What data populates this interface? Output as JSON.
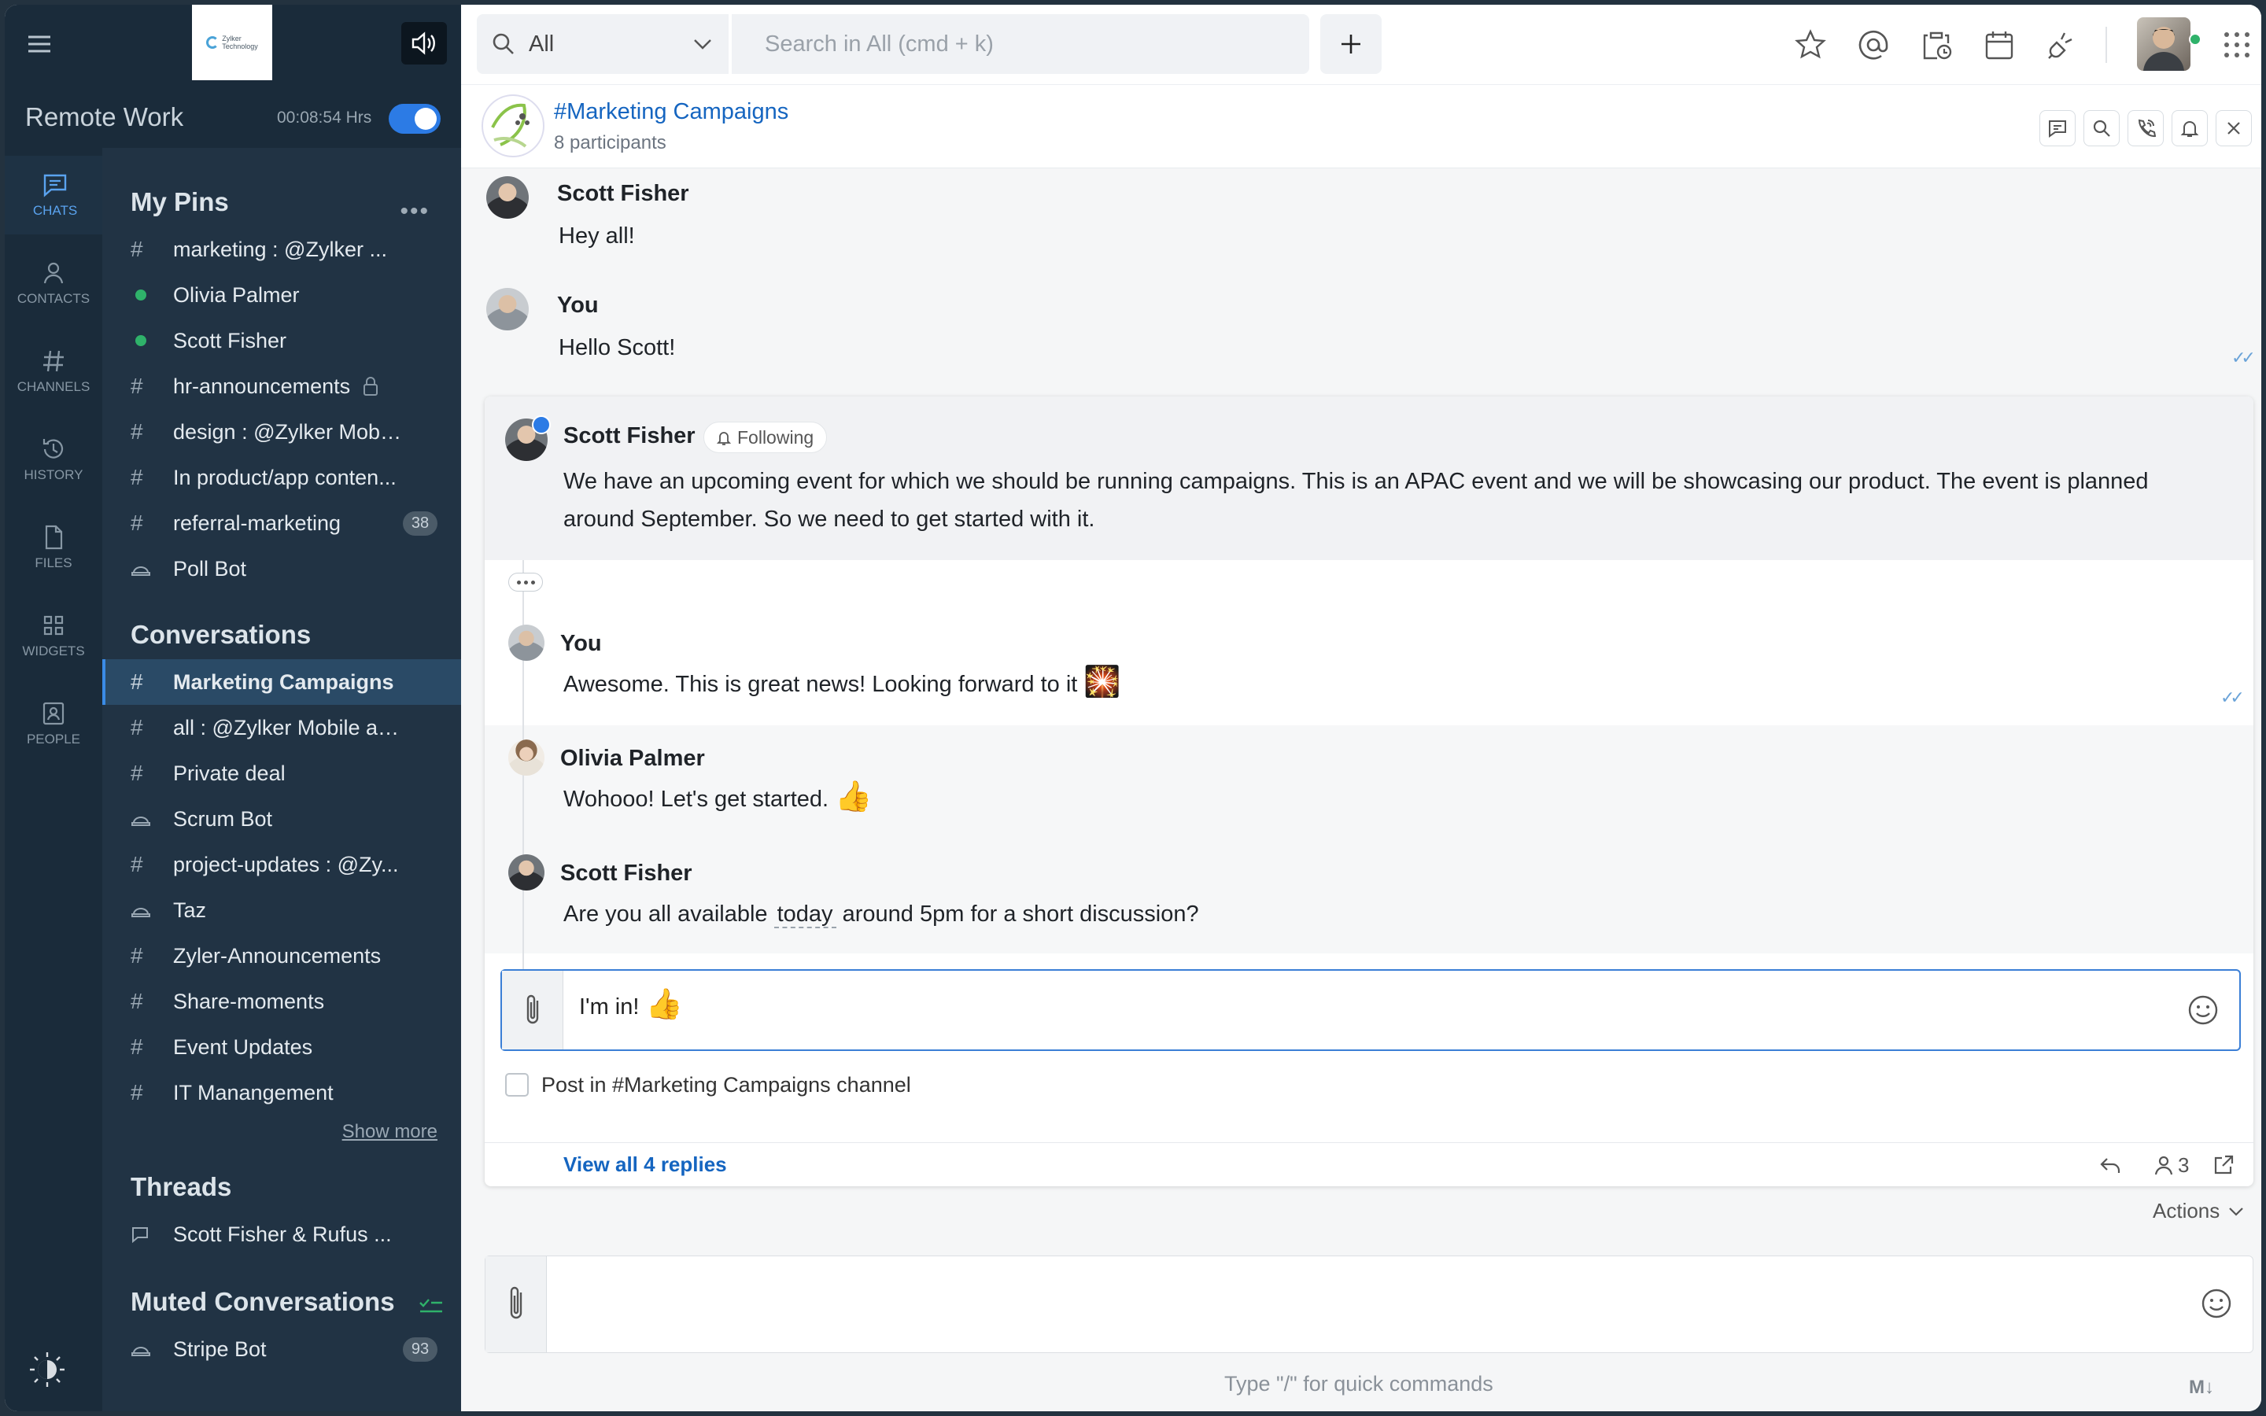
{
  "workspace": {
    "name": "Remote Work",
    "timer": "00:08:54 Hrs"
  },
  "logo_text": [
    "Zylker",
    "Technology"
  ],
  "rail": [
    {
      "label": "CHATS",
      "icon": "chat-icon",
      "active": true
    },
    {
      "label": "CONTACTS",
      "icon": "contact-icon"
    },
    {
      "label": "CHANNELS",
      "icon": "hash-icon"
    },
    {
      "label": "HISTORY",
      "icon": "history-icon"
    },
    {
      "label": "FILES",
      "icon": "file-icon"
    },
    {
      "label": "WIDGETS",
      "icon": "widgets-icon"
    },
    {
      "label": "PEOPLE",
      "icon": "people-icon"
    }
  ],
  "pins": {
    "title": "My Pins",
    "items": [
      {
        "type": "channel",
        "label": "marketing : @Zylker ..."
      },
      {
        "type": "user",
        "label": "Olivia Palmer"
      },
      {
        "type": "user",
        "label": "Scott Fisher"
      },
      {
        "type": "channel",
        "label": "hr-announcements",
        "locked": true
      },
      {
        "type": "channel",
        "label": "design : @Zylker Mobi..."
      },
      {
        "type": "channel",
        "label": "In product/app conten..."
      },
      {
        "type": "channel",
        "label": "referral-marketing",
        "badge": "38"
      },
      {
        "type": "bot",
        "label": "Poll Bot"
      }
    ]
  },
  "conversations": {
    "title": "Conversations",
    "items": [
      {
        "type": "channel",
        "label": "Marketing Campaigns",
        "selected": true
      },
      {
        "type": "channel",
        "label": "all : @Zylker Mobile ap..."
      },
      {
        "type": "channel",
        "label": "Private deal"
      },
      {
        "type": "bot",
        "label": "Scrum Bot"
      },
      {
        "type": "channel",
        "label": "project-updates : @Zy..."
      },
      {
        "type": "bot",
        "label": "Taz"
      },
      {
        "type": "channel",
        "label": "Zyler-Announcements"
      },
      {
        "type": "channel",
        "label": "Share-moments"
      },
      {
        "type": "channel",
        "label": "Event Updates"
      },
      {
        "type": "channel",
        "label": "IT Manangement"
      }
    ],
    "show_more": "Show more"
  },
  "threads": {
    "title": "Threads",
    "items": [
      {
        "label": "Scott Fisher & Rufus ..."
      }
    ]
  },
  "muted": {
    "title": "Muted Conversations",
    "items": [
      {
        "type": "bot",
        "label": "Stripe Bot",
        "badge": "93"
      }
    ]
  },
  "search": {
    "scope": "All",
    "placeholder": "Search in All (cmd + k)"
  },
  "chat": {
    "title": "#Marketing Campaigns",
    "subtitle": "8 participants"
  },
  "messages": [
    {
      "author": "Scott Fisher",
      "text": "Hey all!"
    },
    {
      "author": "You",
      "text": "Hello Scott!"
    }
  ],
  "thread": {
    "parent_author": "Scott Fisher",
    "following": "Following",
    "parent_text": "We have an upcoming event for which we should be running campaigns. This is an APAC event and we will be showcasing our product. The event is planned around September. So we need to get started with it.",
    "replies": [
      {
        "author": "You",
        "text": "Awesome. This is great news! Looking forward to it",
        "emoji": "🎇"
      },
      {
        "author": "Olivia Palmer",
        "text": "Wohooo! Let's get started.",
        "emoji": "👍"
      },
      {
        "author": "Scott Fisher",
        "text_before": "Are you all available",
        "highlight": "today",
        "text_after": "around 5pm for a short discussion?"
      }
    ],
    "draft": "I'm in!",
    "draft_emoji": "👍",
    "post_in_channel": "Post in #Marketing Campaigns channel",
    "view_all": "View all 4 replies",
    "participant_count": "3"
  },
  "actions_label": "Actions",
  "composer_hint": "Type \"/\" for quick commands",
  "markdown_label": "M↓",
  "colors": {
    "accent": "#2c7be5",
    "sidebar": "#213344",
    "rail": "#1a2b3a",
    "link": "#1565c0",
    "online": "#2fb26a"
  }
}
